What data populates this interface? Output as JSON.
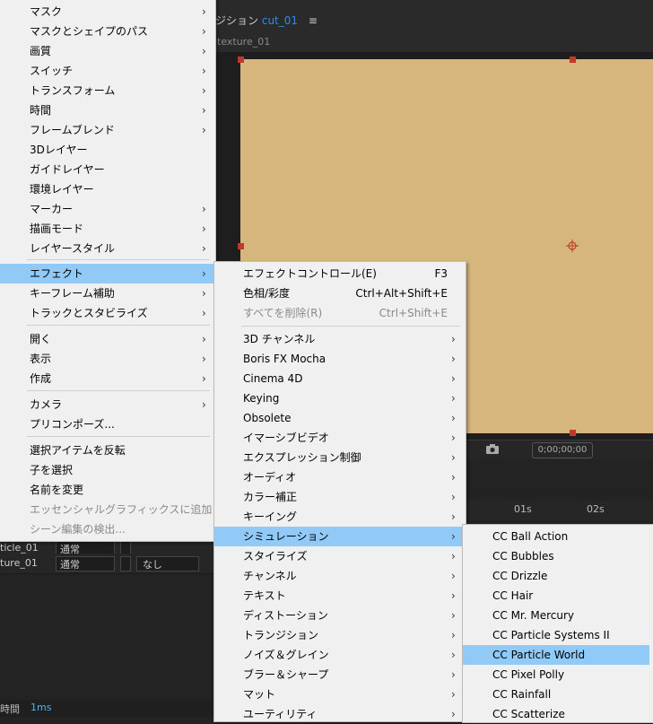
{
  "comp": {
    "title_prefix": "ジション",
    "name": "cut_01",
    "hamburger": "≡",
    "layer_tab": "texture_01",
    "timecode": "0;00;00;00",
    "ruler_1": "01s",
    "ruler_2": "02s",
    "status_label": "時間",
    "status_value": "1ms"
  },
  "layers": [
    {
      "name": "ticle_01",
      "mode": "通常",
      "trk": ""
    },
    {
      "name": "ture_01",
      "mode": "通常",
      "trk": "なし"
    }
  ],
  "menu1": [
    {
      "label": "マスク",
      "arrow": true
    },
    {
      "label": "マスクとシェイプのパス",
      "arrow": true
    },
    {
      "label": "画質",
      "arrow": true
    },
    {
      "label": "スイッチ",
      "arrow": true
    },
    {
      "label": "トランスフォーム",
      "arrow": true
    },
    {
      "label": "時間",
      "arrow": true
    },
    {
      "label": "フレームブレンド",
      "arrow": true
    },
    {
      "label": "3Dレイヤー",
      "arrow": false
    },
    {
      "label": "ガイドレイヤー",
      "arrow": false
    },
    {
      "label": "環境レイヤー",
      "arrow": false
    },
    {
      "label": "マーカー",
      "arrow": true
    },
    {
      "label": "描画モード",
      "arrow": true
    },
    {
      "label": "レイヤースタイル",
      "arrow": true
    },
    {
      "label": "エフェクト",
      "arrow": true,
      "highlight": true
    },
    {
      "label": "キーフレーム補助",
      "arrow": true
    },
    {
      "label": "トラックとスタビライズ",
      "arrow": true
    },
    {
      "label": "開く",
      "arrow": true
    },
    {
      "label": "表示",
      "arrow": true
    },
    {
      "label": "作成",
      "arrow": true
    },
    {
      "label": "カメラ",
      "arrow": true
    },
    {
      "label": "プリコンポーズ...",
      "arrow": false
    },
    {
      "label": "選択アイテムを反転",
      "arrow": false
    },
    {
      "label": "子を選択",
      "arrow": false
    },
    {
      "label": "名前を変更",
      "arrow": false
    },
    {
      "label": "エッセンシャルグラフィックスに追加",
      "arrow": false,
      "disabled": true
    },
    {
      "label": "シーン編集の検出...",
      "arrow": false,
      "disabled": true
    }
  ],
  "menu2": [
    {
      "label": "エフェクトコントロール(E)",
      "shortcut": "F3"
    },
    {
      "label": "色相/彩度",
      "shortcut": "Ctrl+Alt+Shift+E"
    },
    {
      "label": "すべてを削除(R)",
      "shortcut": "Ctrl+Shift+E",
      "disabled": true
    },
    {
      "label": "3D チャンネル",
      "arrow": true
    },
    {
      "label": "Boris FX Mocha",
      "arrow": true
    },
    {
      "label": "Cinema 4D",
      "arrow": true
    },
    {
      "label": "Keying",
      "arrow": true
    },
    {
      "label": "Obsolete",
      "arrow": true
    },
    {
      "label": "イマーシブビデオ",
      "arrow": true
    },
    {
      "label": "エクスプレッション制御",
      "arrow": true
    },
    {
      "label": "オーディオ",
      "arrow": true
    },
    {
      "label": "カラー補正",
      "arrow": true
    },
    {
      "label": "キーイング",
      "arrow": true
    },
    {
      "label": "シミュレーション",
      "arrow": true,
      "highlight": true
    },
    {
      "label": "スタイライズ",
      "arrow": true
    },
    {
      "label": "チャンネル",
      "arrow": true
    },
    {
      "label": "テキスト",
      "arrow": true
    },
    {
      "label": "ディストーション",
      "arrow": true
    },
    {
      "label": "トランジション",
      "arrow": true
    },
    {
      "label": "ノイズ＆グレイン",
      "arrow": true
    },
    {
      "label": "ブラー＆シャープ",
      "arrow": true
    },
    {
      "label": "マット",
      "arrow": true
    },
    {
      "label": "ユーティリティ",
      "arrow": true
    }
  ],
  "menu3": [
    {
      "label": "CC Ball Action"
    },
    {
      "label": "CC Bubbles"
    },
    {
      "label": "CC Drizzle"
    },
    {
      "label": "CC Hair"
    },
    {
      "label": "CC Mr. Mercury"
    },
    {
      "label": "CC Particle Systems II"
    },
    {
      "label": "CC Particle World",
      "highlight": true
    },
    {
      "label": "CC Pixel Polly"
    },
    {
      "label": "CC Rainfall"
    },
    {
      "label": "CC Scatterize"
    }
  ],
  "arrow_glyph": "›",
  "colors": {
    "canvas": "#d7b67e",
    "highlight": "#91c9f7",
    "menu_bg": "#f0f0f0",
    "accent_blue": "#2d8ceb"
  }
}
